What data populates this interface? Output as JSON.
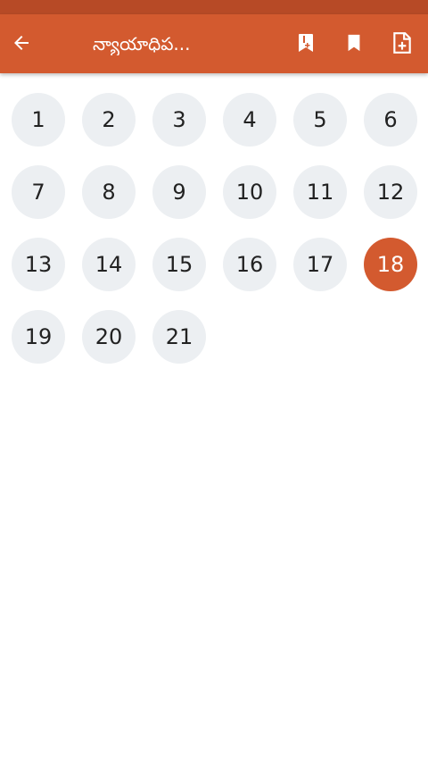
{
  "app_bar": {
    "title": "న్యాయాధిప...",
    "back_icon": "arrow-left-icon",
    "actions": [
      {
        "name": "bookmark-add-icon"
      },
      {
        "name": "bookmark-icon"
      },
      {
        "name": "note-add-icon"
      }
    ],
    "color": "#d35a2f"
  },
  "chapters": {
    "items": [
      "1",
      "2",
      "3",
      "4",
      "5",
      "6",
      "7",
      "8",
      "9",
      "10",
      "11",
      "12",
      "13",
      "14",
      "15",
      "16",
      "17",
      "18",
      "19",
      "20",
      "21"
    ],
    "selected": "18",
    "selected_color": "#d35a2f",
    "default_color": "#eceff2"
  }
}
